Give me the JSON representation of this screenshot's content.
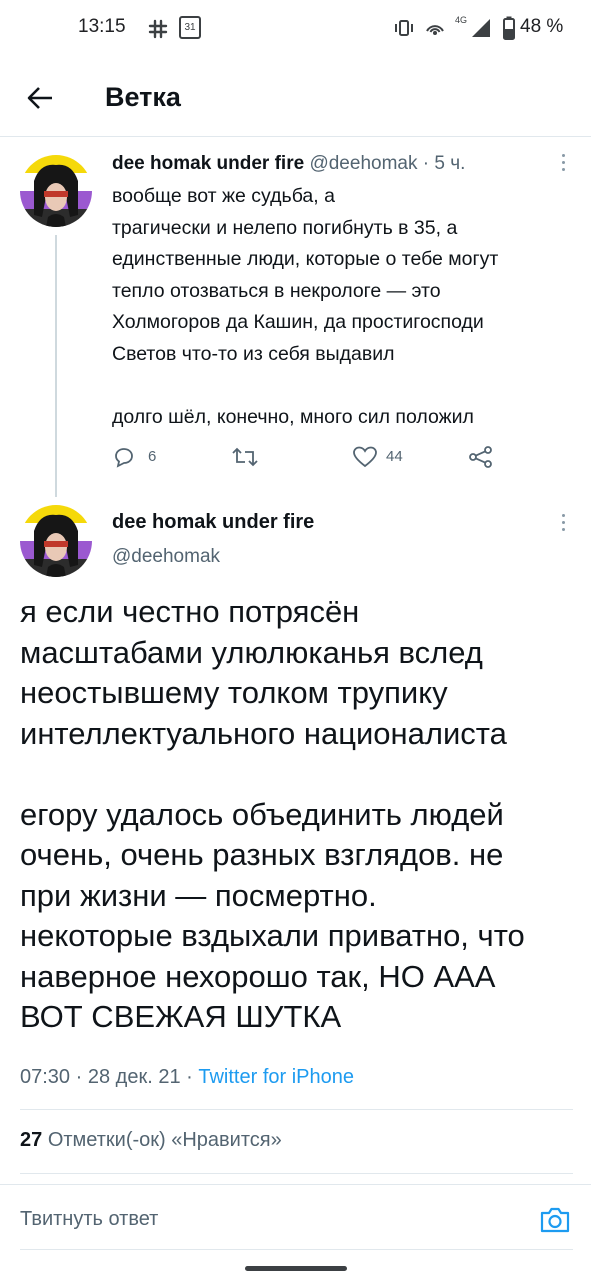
{
  "status_bar": {
    "time": "13:15",
    "calendar_day": "31",
    "network": "4G",
    "battery": "48 %"
  },
  "header": {
    "title": "Ветка"
  },
  "tweet1": {
    "name": "dee homak under fire",
    "handle": "@deehomak",
    "sep": "·",
    "time": "5 ч.",
    "text": "вообще вот же судьба, а\nтрагически и нелепо погибнуть в 35, а\nединственные люди, которые о тебе могут\nтепло отозваться в некрологе — это\nХолмогоров да Кашин, да простигосподи\nСветов что-то из себя выдавил\n\nдолго шёл, конечно, много сил положил",
    "replies": "6",
    "likes": "44"
  },
  "tweet2": {
    "name": "dee homak under fire",
    "handle": "@deehomak",
    "text": "я если честно потрясён\nмасштабами улюлюканья вслед\nнеостывшему толком трупику\nинтеллектуального националиста\n\nегору удалось объединить людей\nочень, очень разных взглядов. не\nпри жизни — посмертно.\nнекоторые вздыхали приватно, что\nнаверное нехорошо так, НО ААА\nВОТ СВЕЖАЯ ШУТКА",
    "time": "07:30",
    "date": "28 дек. 21",
    "sep": "·",
    "source": "Twitter for iPhone",
    "likes_count": "27",
    "likes_label": "Отметки(-ок) «Нравится»"
  },
  "reply": {
    "placeholder": "Твитнуть ответ"
  },
  "colors": {
    "accent": "#1d9bf0",
    "text": "#0f1419",
    "secondary": "#536471"
  }
}
